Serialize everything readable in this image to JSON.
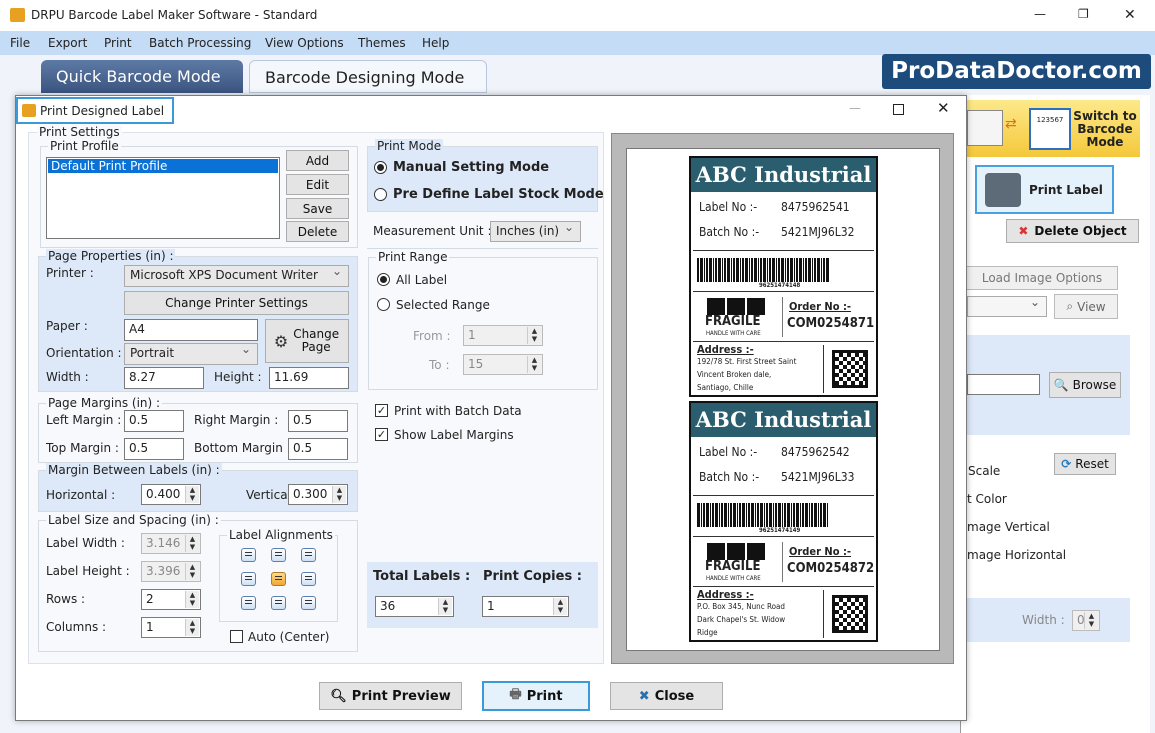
{
  "window": {
    "title": "DRPU Barcode Label Maker Software - Standard",
    "controls": {
      "minimize": "—",
      "restore": "❐",
      "close": "✕"
    }
  },
  "menu": [
    "File",
    "Export",
    "Print",
    "Batch Processing",
    "View Options",
    "Themes",
    "Help"
  ],
  "mode_tabs": {
    "quick": "Quick Barcode Mode",
    "designing": "Barcode Designing Mode"
  },
  "brand": "ProDataDoctor.com",
  "background_panel": {
    "switch_label": "Switch to Barcode Mode",
    "switch_icon_text": "123567",
    "print_label": "Print Label",
    "delete_object": "Delete Object",
    "load_image_options": "Load Image Options",
    "view": "View",
    "browse": "Browse",
    "reset": "Reset",
    "options": [
      "Scale",
      "t Color",
      "mage Vertical",
      "mage Horizontal"
    ],
    "width_label": "Width :",
    "width_value": "0"
  },
  "dialog": {
    "title": "Print Designed Label",
    "print_settings": "Print Settings",
    "print_profile": {
      "legend": "Print Profile",
      "items": [
        "Default Print Profile"
      ],
      "selected": "Default Print Profile",
      "buttons": [
        "Add",
        "Edit",
        "Save",
        "Delete"
      ]
    },
    "page_properties": {
      "legend": "Page Properties (in) :",
      "printer_label": "Printer :",
      "printer": "Microsoft XPS Document Writer",
      "change_printer": "Change Printer Settings",
      "paper_label": "Paper :",
      "paper": "A4",
      "change_page": "Change Page",
      "orientation_label": "Orientation :",
      "orientation": "Portrait",
      "width_label": "Width :",
      "width": "8.27",
      "height_label": "Height :",
      "height": "11.69"
    },
    "page_margins": {
      "legend": "Page Margins (in) :",
      "left_label": "Left Margin :",
      "left": "0.5",
      "right_label": "Right Margin :",
      "right": "0.5",
      "top_label": "Top Margin :",
      "top": "0.5",
      "bottom_label": "Bottom Margin :",
      "bottom": "0.5"
    },
    "margin_between": {
      "legend": "Margin Between Labels (in) :",
      "horizontal_label": "Horizontal :",
      "horizontal": "0.400",
      "vertical_label": "Vertical :",
      "vertical": "0.300"
    },
    "label_size": {
      "legend": "Label Size and Spacing (in) :",
      "width_label": "Label Width :",
      "width": "3.146",
      "height_label": "Label Height :",
      "height": "3.396",
      "rows_label": "Rows :",
      "rows": "2",
      "columns_label": "Columns :",
      "columns": "1",
      "alignments_legend": "Label Alignments",
      "selected_alignment": "middle-center",
      "auto_center": "Auto (Center)",
      "auto_center_checked": false
    },
    "print_mode": {
      "legend": "Print Mode",
      "manual": "Manual Setting Mode",
      "predefine": "Pre Define Label Stock Mode",
      "selected": "manual"
    },
    "measurement": {
      "label": "Measurement Unit :",
      "value": "Inches (in)"
    },
    "print_range": {
      "legend": "Print Range",
      "all": "All Label",
      "selected_range": "Selected Range",
      "selected": "all",
      "from_label": "From :",
      "from": "1",
      "to_label": "To :",
      "to": "15"
    },
    "print_with_batch": {
      "label": "Print with Batch Data",
      "checked": true
    },
    "show_margins": {
      "label": "Show Label Margins",
      "checked": true
    },
    "totals": {
      "total_label": "Total Labels :",
      "total": "36",
      "copies_label": "Print Copies :",
      "copies": "1"
    },
    "buttons": {
      "preview": "Print Preview",
      "print": "Print",
      "close": "Close"
    }
  },
  "labels": [
    {
      "header": "ABC Industrial",
      "label_no_key": "Label No :-",
      "label_no": "8475962541",
      "batch_key": "Batch No :-",
      "batch": "5421MJ96L32",
      "barcode": "96251474148",
      "fragile": "FRAGILE",
      "handle": "HANDLE WITH CARE",
      "order_key": "Order No :-",
      "order": "COM0254871",
      "address_key": "Address :-",
      "address": [
        "192/78 St. First Street Saint",
        "Vincent Broken dale,",
        "Santiago, Chille"
      ]
    },
    {
      "header": "ABC Industrial",
      "label_no_key": "Label No :-",
      "label_no": "8475962542",
      "batch_key": "Batch No :-",
      "batch": "5421MJ96L33",
      "barcode": "96251474149",
      "fragile": "FRAGILE",
      "handle": "HANDLE WITH CARE",
      "order_key": "Order No :-",
      "order": "COM0254872",
      "address_key": "Address :-",
      "address": [
        "P.O. Box 345, Nunc Road",
        "Dark Chapel's St. Widow",
        "Ridge"
      ]
    }
  ],
  "colors": {
    "menu_bg": "#c5dcf7",
    "label_header": "#2a5d6e",
    "brand_bg": "#1d4b7c",
    "highlight": "#3a9ad9"
  }
}
